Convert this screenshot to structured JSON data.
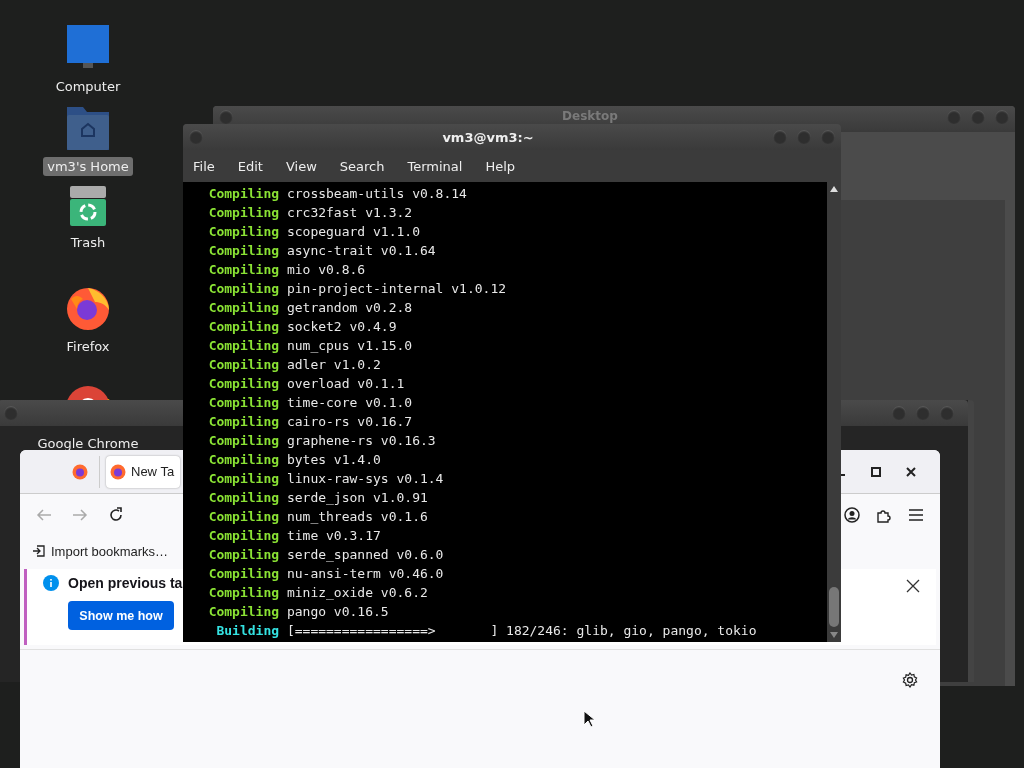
{
  "desktop_icons": [
    {
      "label": "Computer",
      "kind": "computer",
      "selected": false
    },
    {
      "label": "vm3's Home",
      "kind": "home",
      "selected": true
    },
    {
      "label": "Trash",
      "kind": "trash",
      "selected": false
    },
    {
      "label": "Firefox",
      "kind": "firefox",
      "selected": false
    },
    {
      "label": "Google Chrome",
      "kind": "chrome",
      "selected": false
    }
  ],
  "desktop_window": {
    "title": "Desktop"
  },
  "terminal": {
    "title": "vm3@vm3:~",
    "menu": [
      "File",
      "Edit",
      "View",
      "Search",
      "Terminal",
      "Help"
    ],
    "lines": [
      {
        "kind": "compiling",
        "status": "Compiling",
        "text": "crossbeam-utils v0.8.14"
      },
      {
        "kind": "compiling",
        "status": "Compiling",
        "text": "crc32fast v1.3.2"
      },
      {
        "kind": "compiling",
        "status": "Compiling",
        "text": "scopeguard v1.1.0"
      },
      {
        "kind": "compiling",
        "status": "Compiling",
        "text": "async-trait v0.1.64"
      },
      {
        "kind": "compiling",
        "status": "Compiling",
        "text": "mio v0.8.6"
      },
      {
        "kind": "compiling",
        "status": "Compiling",
        "text": "pin-project-internal v1.0.12"
      },
      {
        "kind": "compiling",
        "status": "Compiling",
        "text": "getrandom v0.2.8"
      },
      {
        "kind": "compiling",
        "status": "Compiling",
        "text": "socket2 v0.4.9"
      },
      {
        "kind": "compiling",
        "status": "Compiling",
        "text": "num_cpus v1.15.0"
      },
      {
        "kind": "compiling",
        "status": "Compiling",
        "text": "adler v1.0.2"
      },
      {
        "kind": "compiling",
        "status": "Compiling",
        "text": "overload v0.1.1"
      },
      {
        "kind": "compiling",
        "status": "Compiling",
        "text": "time-core v0.1.0"
      },
      {
        "kind": "compiling",
        "status": "Compiling",
        "text": "cairo-rs v0.16.7"
      },
      {
        "kind": "compiling",
        "status": "Compiling",
        "text": "graphene-rs v0.16.3"
      },
      {
        "kind": "compiling",
        "status": "Compiling",
        "text": "bytes v1.4.0"
      },
      {
        "kind": "compiling",
        "status": "Compiling",
        "text": "linux-raw-sys v0.1.4"
      },
      {
        "kind": "compiling",
        "status": "Compiling",
        "text": "serde_json v1.0.91"
      },
      {
        "kind": "compiling",
        "status": "Compiling",
        "text": "num_threads v0.1.6"
      },
      {
        "kind": "compiling",
        "status": "Compiling",
        "text": "time v0.3.17"
      },
      {
        "kind": "compiling",
        "status": "Compiling",
        "text": "serde_spanned v0.6.0"
      },
      {
        "kind": "compiling",
        "status": "Compiling",
        "text": "nu-ansi-term v0.46.0"
      },
      {
        "kind": "compiling",
        "status": "Compiling",
        "text": "miniz_oxide v0.6.2"
      },
      {
        "kind": "compiling",
        "status": "Compiling",
        "text": "pango v0.16.5"
      },
      {
        "kind": "building",
        "status": "Building",
        "text": "[=================>       ] 182/246: glib, gio, pango, tokio"
      }
    ]
  },
  "browser": {
    "tabs": [
      {
        "kind": "view",
        "selected": false
      },
      {
        "kind": "page",
        "label": "New Ta",
        "selected": true
      }
    ],
    "bookmark": "Import bookmarks…",
    "notification": {
      "title": "Open previous ta",
      "button": "Show me how"
    }
  }
}
